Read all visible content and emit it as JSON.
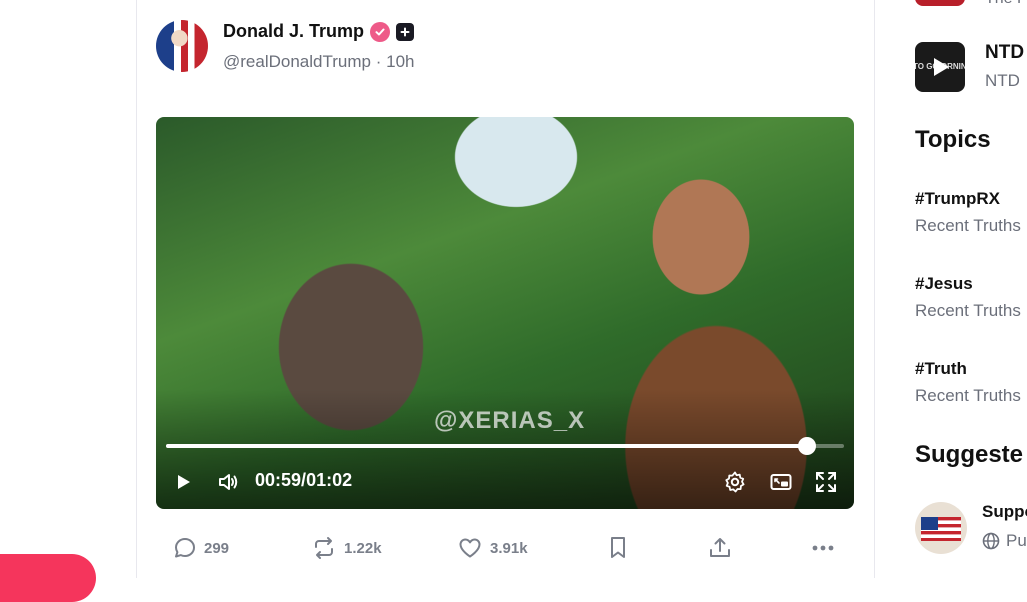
{
  "post": {
    "author_name": "Donald J. Trump",
    "handle": "@realDonaldTrump",
    "time_sep": "·",
    "time": "10h",
    "verified_icon": "verified-badge-icon",
    "plus_icon": "plus-badge-icon"
  },
  "video": {
    "watermark": "@XERIAS_X",
    "current_time": "00:59",
    "time_separator": "/",
    "duration": "01:02",
    "progress": 0.945
  },
  "actions": {
    "replies": "299",
    "retruths": "1.22k",
    "likes": "3.91k"
  },
  "right": {
    "top_item_text": "The F",
    "ntd_name": "NTD",
    "ntd_sub": "NTD",
    "ntd_thumb_text": "TO GO ORNIN",
    "topics_title": "Topics",
    "topics": [
      {
        "tag": "#TrumpRX",
        "sub": "Recent Truths"
      },
      {
        "tag": "#Jesus",
        "sub": "Recent Truths"
      },
      {
        "tag": "#Truth",
        "sub": "Recent Truths"
      }
    ],
    "suggested_title": "Suggeste",
    "suggested_name": "Suppo",
    "suggested_sub": "Pu"
  },
  "colors": {
    "accent": "#f5355c",
    "verified": "#ee5a88",
    "muted": "#6b6f7a"
  }
}
